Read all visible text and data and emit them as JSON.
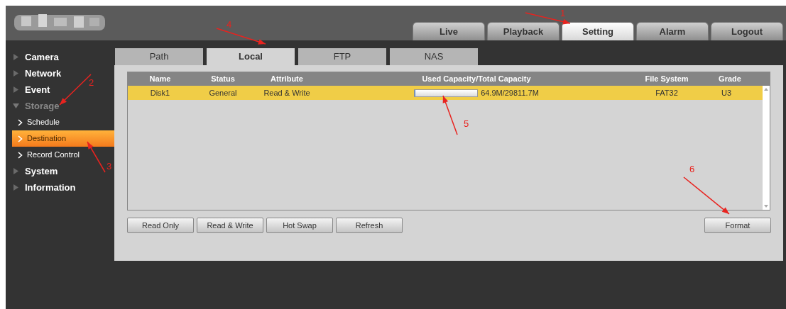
{
  "top_tabs": [
    {
      "label": "Live",
      "selected": false
    },
    {
      "label": "Playback",
      "selected": false
    },
    {
      "label": "Setting",
      "selected": true
    },
    {
      "label": "Alarm",
      "selected": false
    },
    {
      "label": "Logout",
      "selected": false
    }
  ],
  "sidebar": {
    "items": [
      {
        "label": "Camera",
        "expanded": false
      },
      {
        "label": "Network",
        "expanded": false
      },
      {
        "label": "Event",
        "expanded": false
      },
      {
        "label": "Storage",
        "expanded": true,
        "children": [
          {
            "label": "Schedule",
            "selected": false
          },
          {
            "label": "Destination",
            "selected": true
          },
          {
            "label": "Record Control",
            "selected": false
          }
        ]
      },
      {
        "label": "System",
        "expanded": false
      },
      {
        "label": "Information",
        "expanded": false
      }
    ]
  },
  "sub_tabs": [
    {
      "label": "Path",
      "selected": false
    },
    {
      "label": "Local",
      "selected": true
    },
    {
      "label": "FTP",
      "selected": false
    },
    {
      "label": "NAS",
      "selected": false
    }
  ],
  "table": {
    "columns": [
      "Name",
      "Status",
      "Attribute",
      "Used Capacity/Total Capacity",
      "File System",
      "Grade"
    ],
    "rows": [
      {
        "selected": true,
        "name": "Disk1",
        "status": "General",
        "attribute": "Read & Write",
        "level": 0.002,
        "capacity": "64.9M/29811.7M",
        "file_system": "FAT32",
        "grade": "U3"
      }
    ]
  },
  "buttons": [
    "Read Only",
    "Read & Write",
    "Hot Swap",
    "Refresh"
  ],
  "format_button": "Format",
  "annotations": [
    {
      "label": "1"
    },
    {
      "label": "2"
    },
    {
      "label": "3"
    },
    {
      "label": "4"
    },
    {
      "label": "5"
    },
    {
      "label": "6"
    }
  ]
}
